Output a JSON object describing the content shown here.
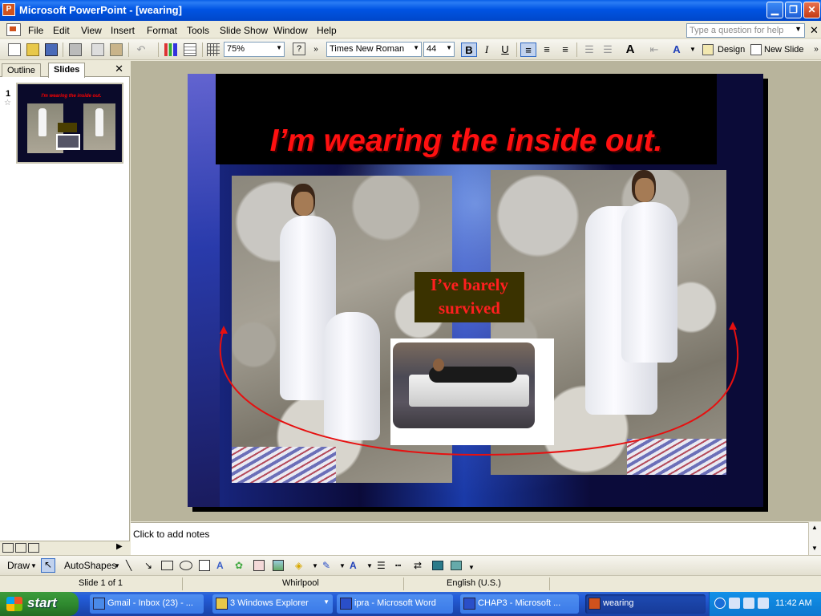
{
  "window": {
    "title": "Microsoft PowerPoint - [wearing]"
  },
  "menu": [
    "File",
    "Edit",
    "View",
    "Insert",
    "Format",
    "Tools",
    "Slide Show",
    "Window",
    "Help"
  ],
  "help_box": {
    "placeholder": "Type a question for help"
  },
  "toolbar": {
    "zoom": "75%",
    "font": "Times New Roman",
    "font_size": "44",
    "bold": "B",
    "italic": "I",
    "underline": "U",
    "design_label": "Design",
    "new_slide_label": "New Slide"
  },
  "left_pane": {
    "tabs": [
      "Outline",
      "Slides"
    ],
    "active_tab": "Slides",
    "slide_number": "1",
    "thumb_title": "I'm wearing the inside out."
  },
  "slide": {
    "title": "I’m wearing the inside out.",
    "caption": "I’ve barely survived"
  },
  "notes": {
    "placeholder": "Click to add notes"
  },
  "drawbar": {
    "draw": "Draw",
    "autoshapes": "AutoShapes"
  },
  "status": {
    "slide": "Slide 1 of 1",
    "design": "Whirlpool",
    "language": "English (U.S.)"
  },
  "taskbar": {
    "start": "start",
    "tasks": [
      "Gmail - Inbox (23) - ...",
      "3 Windows Explorer",
      "ipra - Microsoft Word",
      "CHAP3 - Microsoft ...",
      "wearing"
    ],
    "clock": "11:42 AM"
  }
}
